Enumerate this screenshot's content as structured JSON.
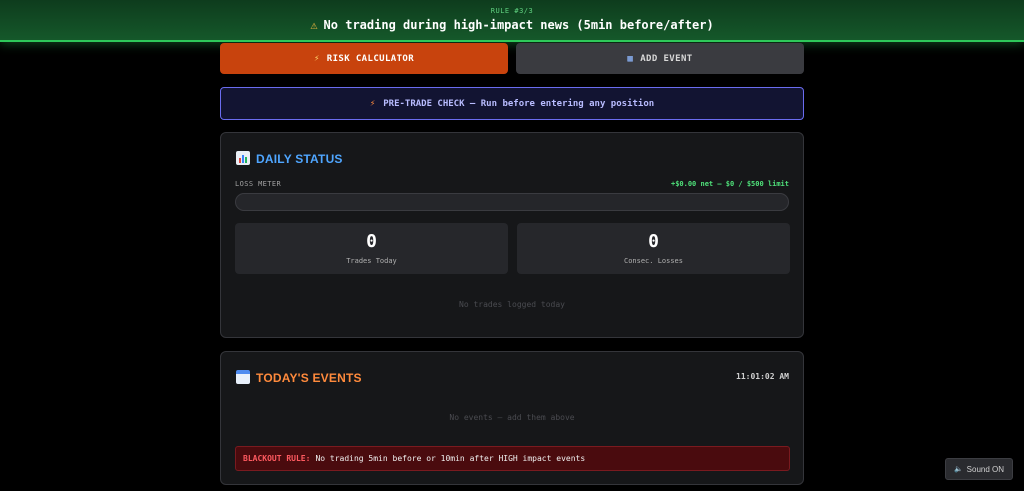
{
  "banner": {
    "rule_counter": "RULE #3/3",
    "rule_text": "No trading during high-impact news (5min before/after)",
    "icon": "warning-icon"
  },
  "buttons": {
    "risk_calculator": {
      "label": "RISK CALCULATOR",
      "icon": "lightning-icon",
      "color": "#c8430d"
    },
    "add_event": {
      "label": "ADD EVENT",
      "icon": "calendar-icon",
      "color": "#3a3b40"
    }
  },
  "pretrade": {
    "label": "PRE-TRADE CHECK — Run before entering any position",
    "icon": "lightning-icon",
    "accent": "#6a6cf0"
  },
  "daily_status": {
    "title": "DAILY STATUS",
    "icon": "bar-chart-icon",
    "loss_meter_label": "LOSS METER",
    "loss_meter_value": "+$0.00 net — $0 / $500 limit",
    "loss_meter_fraction": 0,
    "trades_today": {
      "value": "0",
      "label": "Trades Today"
    },
    "consec_losses": {
      "value": "0",
      "label": "Consec. Losses"
    },
    "empty_text": "No trades logged today"
  },
  "events": {
    "title": "TODAY'S EVENTS",
    "icon": "calendar-icon",
    "clock": "11:01:02 AM",
    "empty_text": "No events — add them above",
    "blackout_label": "BLACKOUT RULE:",
    "blackout_text": "No trading 5min before or 10min after HIGH impact events"
  },
  "sound": {
    "label": "Sound ON",
    "icon": "speaker-icon"
  },
  "colors": {
    "banner_bg": "#15582a",
    "banner_border": "#2ec95a",
    "daily_title": "#4fa6ff",
    "events_title": "#ff8a3c",
    "positive": "#4fe07a",
    "blackout_bg": "#4a0b0e"
  }
}
